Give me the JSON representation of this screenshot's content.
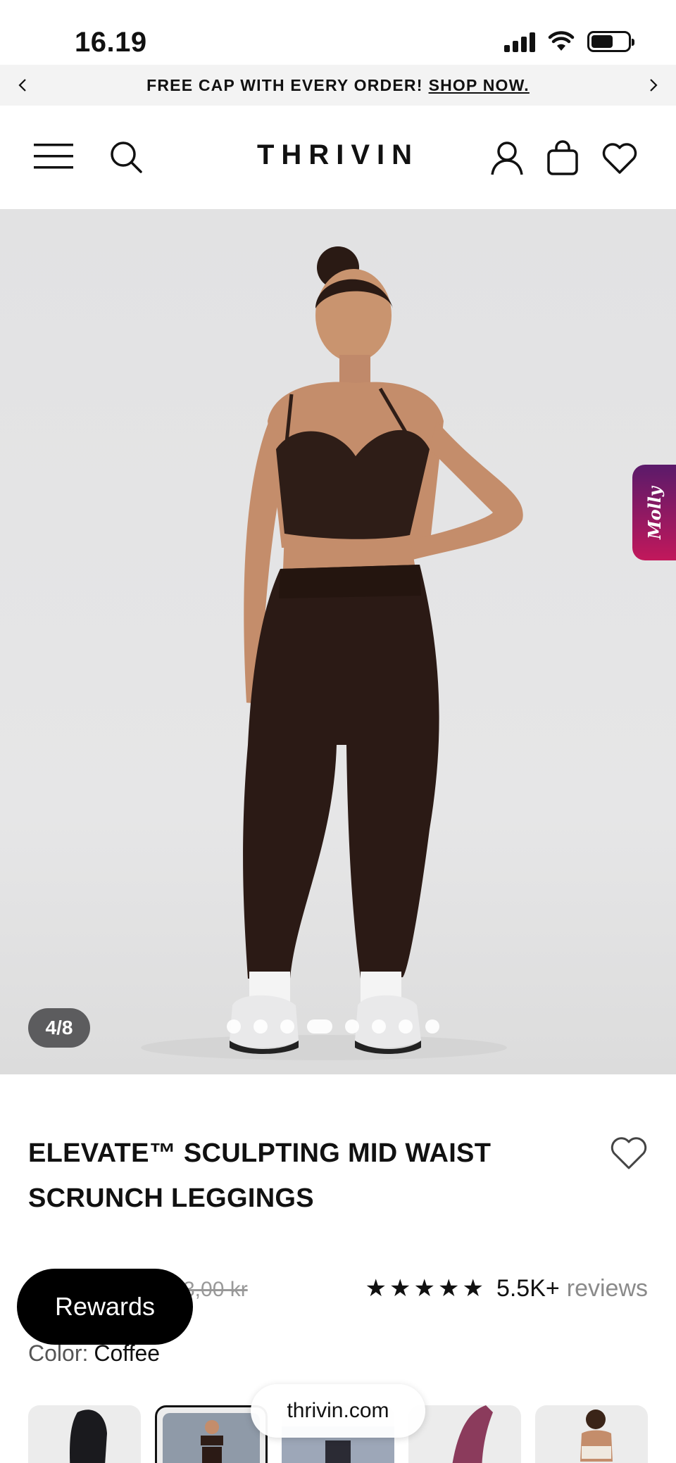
{
  "status": {
    "time": "16.19"
  },
  "announcement": {
    "text": "FREE CAP WITH EVERY ORDER!",
    "link": "SHOP NOW."
  },
  "header": {
    "logo": "THRIVIN"
  },
  "gallery": {
    "counter": "4/8",
    "total_images": 8,
    "active_index": 4
  },
  "chat_widget": {
    "label": "Molly"
  },
  "product": {
    "title_line1": "ELEVATE™ SCULPTING MID WAIST",
    "title_line2": "SCRUNCH LEGGINGS",
    "old_price_fragment": "3,00 kr",
    "stars": "★★★★★",
    "rating_value": 5,
    "review_count": "5.5K+",
    "review_word": "reviews",
    "color_label": "Color:",
    "color_value": "Coffee"
  },
  "rewards": {
    "label": "Rewards"
  },
  "browser": {
    "url": "thrivin.com"
  },
  "colors": {
    "accent": "#111111",
    "announce_bg": "#f3f3f3",
    "hero_bg": "#e4e4e5",
    "counter_bg": "#5c5c5e",
    "molly_gradient_top": "#5a1a6a",
    "molly_gradient_bottom": "#c2185b"
  }
}
